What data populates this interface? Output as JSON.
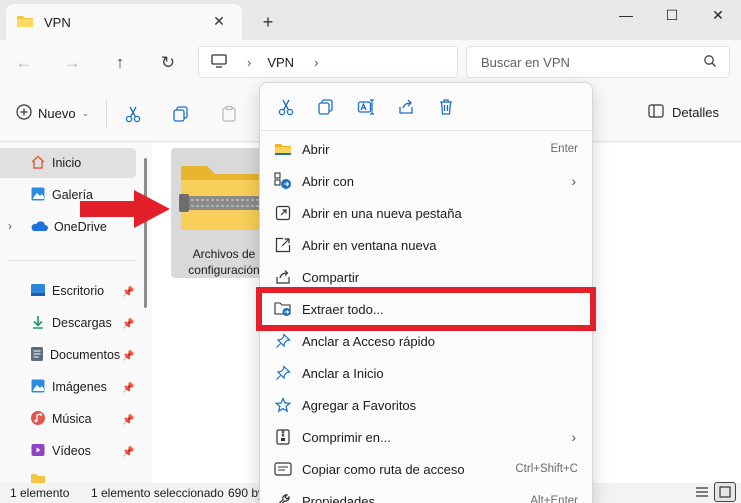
{
  "window": {
    "tab_title": "VPN",
    "minimize": "—",
    "maximize": "☐",
    "close": "✕",
    "tab_close": "✕",
    "new_tab": "+"
  },
  "address": {
    "crumb": "VPN",
    "search_placeholder": "Buscar en VPN"
  },
  "toolbar": {
    "new_label": "Nuevo",
    "details_label": "Detalles"
  },
  "sidebar": {
    "items": [
      {
        "label": "Inicio"
      },
      {
        "label": "Galería"
      },
      {
        "label": "OneDrive"
      },
      {
        "label": "Escritorio"
      },
      {
        "label": "Descargas"
      },
      {
        "label": "Documentos"
      },
      {
        "label": "Imágenes"
      },
      {
        "label": "Música"
      },
      {
        "label": "Vídeos"
      }
    ]
  },
  "content": {
    "file_label_line1": "Archivos de",
    "file_label_line2": "configuración"
  },
  "status": {
    "count": "1 elemento",
    "selected": "1 elemento seleccionado",
    "size": "690 by"
  },
  "menu": {
    "items": [
      {
        "label": "Abrir",
        "shortcut": "Enter"
      },
      {
        "label": "Abrir con",
        "shortcut": ""
      },
      {
        "label": "Abrir en una nueva pestaña",
        "shortcut": ""
      },
      {
        "label": "Abrir en ventana nueva",
        "shortcut": ""
      },
      {
        "label": "Compartir",
        "shortcut": ""
      },
      {
        "label": "Extraer todo...",
        "shortcut": ""
      },
      {
        "label": "Anclar a Acceso rápido",
        "shortcut": ""
      },
      {
        "label": "Anclar a Inicio",
        "shortcut": ""
      },
      {
        "label": "Agregar a Favoritos",
        "shortcut": ""
      },
      {
        "label": "Comprimir en...",
        "shortcut": ""
      },
      {
        "label": "Copiar como ruta de acceso",
        "shortcut": "Ctrl+Shift+C"
      },
      {
        "label": "Propiedades",
        "shortcut": "Alt+Enter"
      }
    ]
  },
  "colors": {
    "highlight": "#e3202a",
    "arrow": "#e3202a",
    "folder": "#f5c443",
    "accent": "#0067c0"
  }
}
